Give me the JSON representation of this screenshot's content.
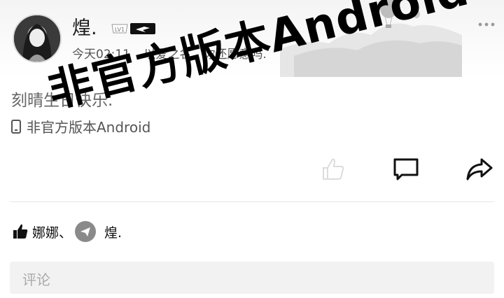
{
  "post": {
    "username": "煌.",
    "level_badge": "LV1",
    "time": "今天02:11",
    "signature": "以爱之名，你还愿意吗.",
    "content": "刻晴生日快乐.",
    "client": "非官方版本Android"
  },
  "watermark": "非官方版本Android",
  "likes": {
    "first": "娜娜、",
    "second": "煌."
  },
  "comment": {
    "placeholder": "评论"
  },
  "icons": [
    "more-icon",
    "phone-icon",
    "like-icon",
    "comment-icon",
    "share-icon",
    "thumb-icon",
    "paper-plane-icon"
  ]
}
